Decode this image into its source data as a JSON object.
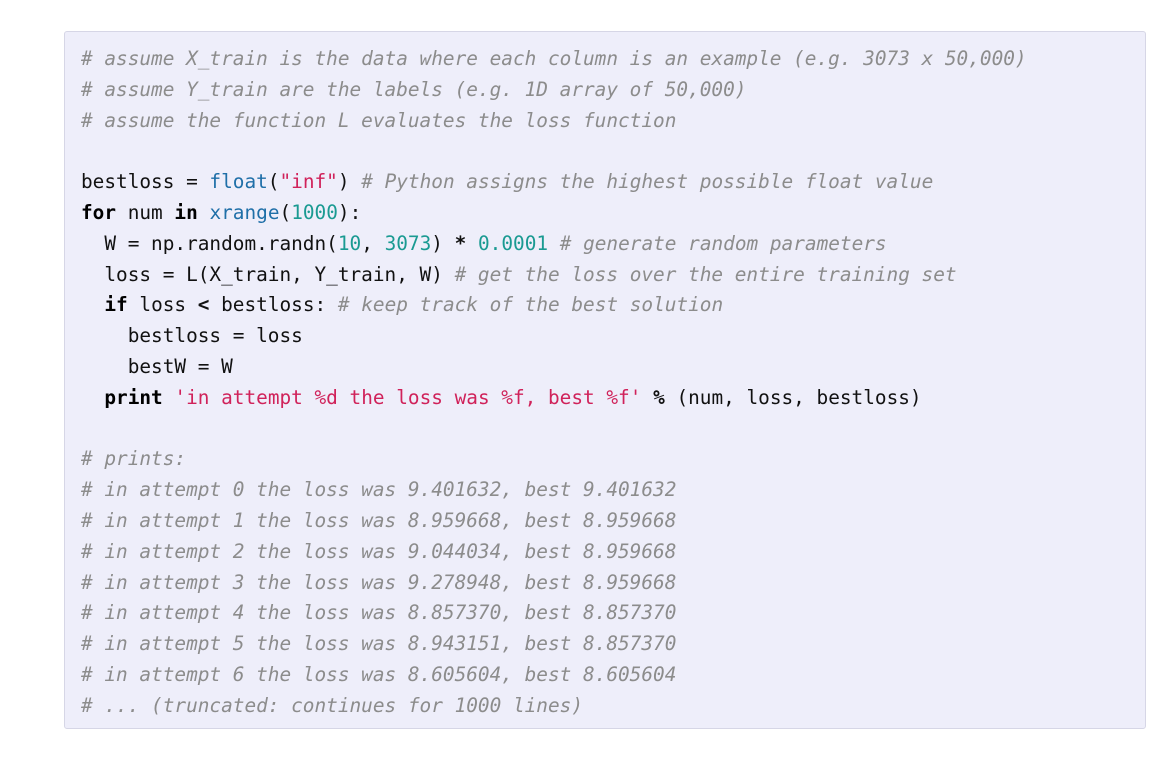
{
  "code": {
    "language": "python",
    "lines": [
      [
        {
          "t": "# assume X_train is the data where each column is an example (e.g. 3073 x 50,000)",
          "k": "comment"
        }
      ],
      [
        {
          "t": "# assume Y_train are the labels (e.g. 1D array of 50,000)",
          "k": "comment"
        }
      ],
      [
        {
          "t": "# assume the function L evaluates the loss function",
          "k": "comment"
        }
      ],
      [],
      [
        {
          "t": "bestloss = ",
          "k": "plain"
        },
        {
          "t": "float",
          "k": "builtin"
        },
        {
          "t": "(",
          "k": "plain"
        },
        {
          "t": "\"inf\"",
          "k": "string"
        },
        {
          "t": ") ",
          "k": "plain"
        },
        {
          "t": "# Python assigns the highest possible float value",
          "k": "comment"
        }
      ],
      [
        {
          "t": "for",
          "k": "keyword"
        },
        {
          "t": " num ",
          "k": "plain"
        },
        {
          "t": "in",
          "k": "keyword"
        },
        {
          "t": " ",
          "k": "plain"
        },
        {
          "t": "xrange",
          "k": "builtin"
        },
        {
          "t": "(",
          "k": "plain"
        },
        {
          "t": "1000",
          "k": "number"
        },
        {
          "t": "):",
          "k": "plain"
        }
      ],
      [
        {
          "t": "  W = np.random.randn(",
          "k": "plain"
        },
        {
          "t": "10",
          "k": "number"
        },
        {
          "t": ", ",
          "k": "plain"
        },
        {
          "t": "3073",
          "k": "number"
        },
        {
          "t": ") ",
          "k": "plain"
        },
        {
          "t": "*",
          "k": "op"
        },
        {
          "t": " ",
          "k": "plain"
        },
        {
          "t": "0.0001",
          "k": "number"
        },
        {
          "t": " ",
          "k": "plain"
        },
        {
          "t": "# generate random parameters",
          "k": "comment"
        }
      ],
      [
        {
          "t": "  loss = L(X_train, Y_train, W) ",
          "k": "plain"
        },
        {
          "t": "# get the loss over the entire training set",
          "k": "comment"
        }
      ],
      [
        {
          "t": "  ",
          "k": "plain"
        },
        {
          "t": "if",
          "k": "keyword"
        },
        {
          "t": " loss ",
          "k": "plain"
        },
        {
          "t": "<",
          "k": "op"
        },
        {
          "t": " bestloss: ",
          "k": "plain"
        },
        {
          "t": "# keep track of the best solution",
          "k": "comment"
        }
      ],
      [
        {
          "t": "    bestloss = loss",
          "k": "plain"
        }
      ],
      [
        {
          "t": "    bestW = W",
          "k": "plain"
        }
      ],
      [
        {
          "t": "  ",
          "k": "plain"
        },
        {
          "t": "print",
          "k": "keyword"
        },
        {
          "t": " ",
          "k": "plain"
        },
        {
          "t": "'in attempt %d the loss was %f, best %f'",
          "k": "string"
        },
        {
          "t": " ",
          "k": "plain"
        },
        {
          "t": "%",
          "k": "op"
        },
        {
          "t": " (num, loss, bestloss)",
          "k": "plain"
        }
      ],
      [],
      [
        {
          "t": "# prints:",
          "k": "comment"
        }
      ],
      [
        {
          "t": "# in attempt 0 the loss was 9.401632, best 9.401632",
          "k": "comment"
        }
      ],
      [
        {
          "t": "# in attempt 1 the loss was 8.959668, best 8.959668",
          "k": "comment"
        }
      ],
      [
        {
          "t": "# in attempt 2 the loss was 9.044034, best 8.959668",
          "k": "comment"
        }
      ],
      [
        {
          "t": "# in attempt 3 the loss was 9.278948, best 8.959668",
          "k": "comment"
        }
      ],
      [
        {
          "t": "# in attempt 4 the loss was 8.857370, best 8.857370",
          "k": "comment"
        }
      ],
      [
        {
          "t": "# in attempt 5 the loss was 8.943151, best 8.857370",
          "k": "comment"
        }
      ],
      [
        {
          "t": "# in attempt 6 the loss was 8.605604, best 8.605604",
          "k": "comment"
        }
      ],
      [
        {
          "t": "# ... (truncated: continues for 1000 lines)",
          "k": "comment"
        }
      ]
    ]
  },
  "colors": {
    "background": "#eeeefa",
    "comment": "#8c8c8c",
    "keyword": "#000000",
    "builtin": "#1f6fa8",
    "string": "#d0225a",
    "number": "#1a9a92"
  }
}
